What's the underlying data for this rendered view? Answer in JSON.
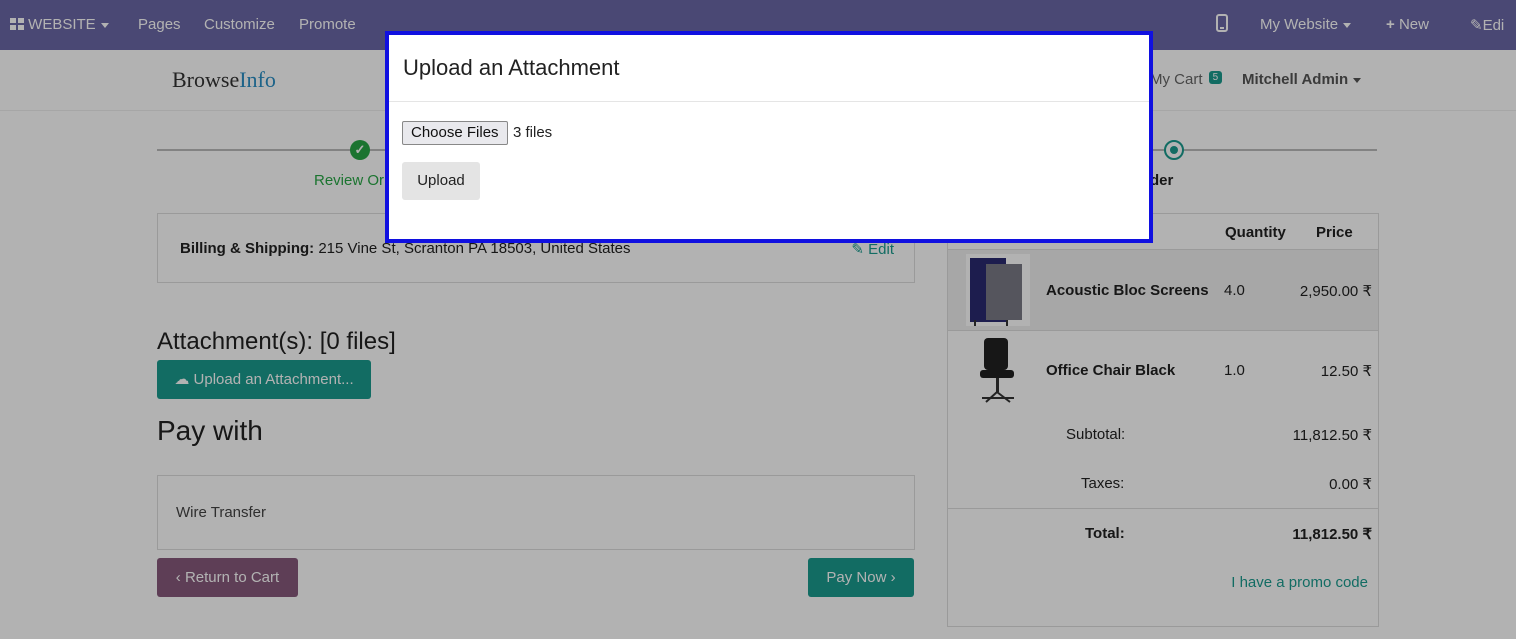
{
  "topbar": {
    "website": "WEBSITE",
    "pages": "Pages",
    "customize": "Customize",
    "promote": "Promote",
    "my_website": "My Website",
    "new": "New",
    "edit": "Edi"
  },
  "header": {
    "logo_a": "Browse",
    "logo_b": "Info",
    "cart": "My Cart",
    "cart_count": "5",
    "user": "Mitchell Admin"
  },
  "steps": {
    "review": "Review Or",
    "confirm": "firm Order"
  },
  "billing": {
    "label": "Billing & Shipping:",
    "address": " 215 Vine St, Scranton PA 18503, United States",
    "edit": "Edit"
  },
  "attachments": {
    "title": "Attachment(s): [0 files]",
    "button": "Upload an Attachment..."
  },
  "payment": {
    "title": "Pay with",
    "method": "Wire Transfer",
    "return": "Return to Cart",
    "pay": "Pay Now"
  },
  "order": {
    "headers": {
      "quantity": "Quantity",
      "price": "Price"
    },
    "items": [
      {
        "name": "Acoustic Bloc Screens",
        "qty": "4.0",
        "price": "2,950.00 ₹"
      },
      {
        "name": "Office Chair Black",
        "qty": "1.0",
        "price": "12.50 ₹"
      }
    ],
    "subtotal_label": "Subtotal:",
    "subtotal": "11,812.50 ₹",
    "taxes_label": "Taxes:",
    "taxes": "0.00 ₹",
    "total_label": "Total:",
    "total": "11,812.50 ₹",
    "promo": "I have a promo code"
  },
  "modal": {
    "title": "Upload an Attachment",
    "choose": "Choose Files",
    "files": "3 files",
    "upload": "Upload"
  },
  "colors": {
    "topbar": "#6b67a6",
    "accent": "#1a9b8f",
    "return": "#875a7b",
    "modal_border": "#1010e0"
  }
}
